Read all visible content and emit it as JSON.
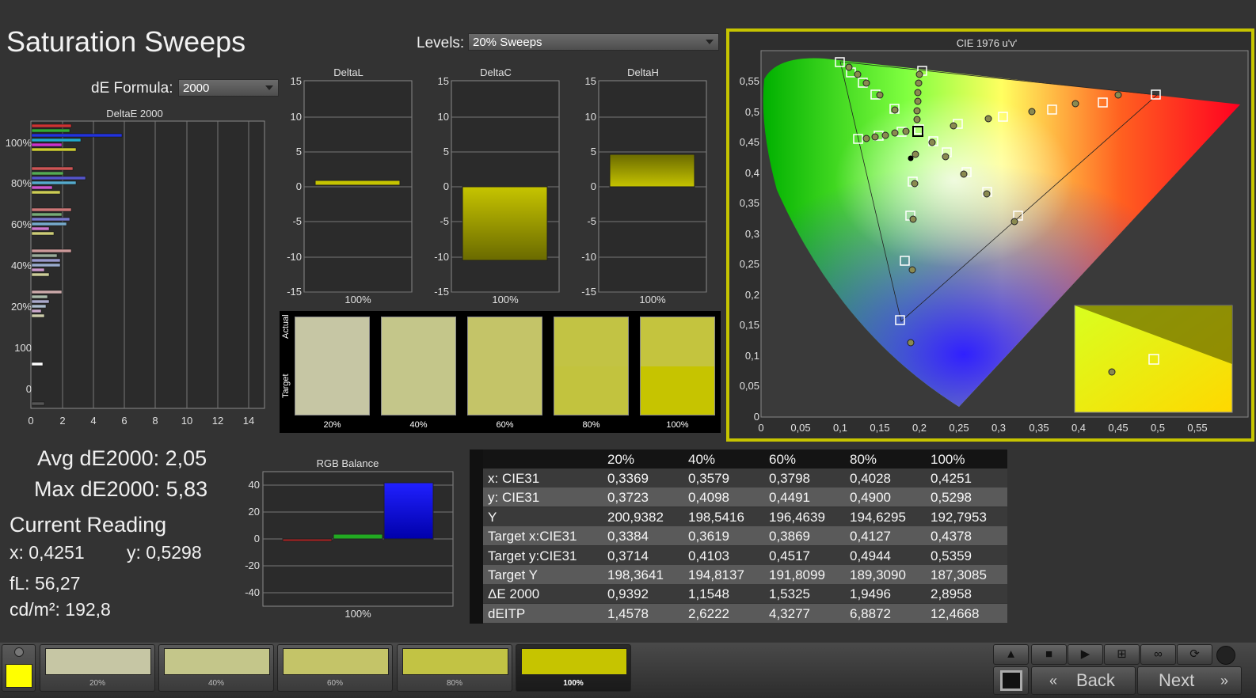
{
  "title": "Saturation Sweeps",
  "levels": {
    "label": "Levels:",
    "value": "20% Sweeps"
  },
  "formula": {
    "label": "dE Formula:",
    "value": "2000"
  },
  "deltae_chart": {
    "title": "DeltaE 2000",
    "x_ticks": [
      "0",
      "2",
      "4",
      "6",
      "8",
      "10",
      "12",
      "14"
    ],
    "y_labels": [
      "100%",
      "80%",
      "60%",
      "40%",
      "20%",
      "100",
      "0"
    ]
  },
  "deltaL": {
    "title": "DeltaL",
    "y_ticks": [
      "15",
      "10",
      "5",
      "0",
      "-5",
      "-10",
      "-15"
    ],
    "x_label": "100%"
  },
  "deltaC": {
    "title": "DeltaC",
    "y_ticks": [
      "15",
      "10",
      "5",
      "0",
      "-5",
      "-10",
      "-15"
    ],
    "x_label": "100%"
  },
  "deltaH": {
    "title": "DeltaH",
    "y_ticks": [
      "15",
      "10",
      "5",
      "0",
      "-5",
      "-10",
      "-15"
    ],
    "x_label": "100%"
  },
  "swatches": {
    "actual_label": "Actual",
    "target_label": "Target",
    "items": [
      {
        "label": "20%",
        "actual": "#c6c6a4",
        "target": "#c6c6a4"
      },
      {
        "label": "40%",
        "actual": "#c4c68a",
        "target": "#c4c68a"
      },
      {
        "label": "60%",
        "actual": "#c4c468",
        "target": "#c4c468"
      },
      {
        "label": "80%",
        "actual": "#c2c344",
        "target": "#c2c33e"
      },
      {
        "label": "100%",
        "actual": "#c4c43e",
        "target": "#c6c400"
      }
    ]
  },
  "cie": {
    "title": "CIE 1976 u'v'",
    "x_ticks": [
      "0",
      "0,05",
      "0,1",
      "0,15",
      "0,2",
      "0,25",
      "0,3",
      "0,35",
      "0,4",
      "0,45",
      "0,5",
      "0,55"
    ],
    "y_ticks": [
      "0",
      "0,05",
      "0,1",
      "0,15",
      "0,2",
      "0,25",
      "0,3",
      "0,35",
      "0,4",
      "0,45",
      "0,5",
      "0,55"
    ]
  },
  "stats": {
    "avg": "Avg dE2000: 2,05",
    "max": "Max dE2000: 5,83",
    "current_reading": "Current Reading",
    "x": "x: 0,4251",
    "y": "y: 0,5298",
    "fl": "fL: 56,27",
    "cdm2": "cd/m²: 192,8"
  },
  "rgb_balance": {
    "title": "RGB Balance",
    "y_ticks": [
      "40",
      "20",
      "0",
      "-20",
      "-40"
    ],
    "x_label": "100%"
  },
  "table": {
    "headers": [
      "20%",
      "40%",
      "60%",
      "80%",
      "100%"
    ],
    "rows": [
      {
        "label": "x: CIE31",
        "values": [
          "0,3369",
          "0,3579",
          "0,3798",
          "0,4028",
          "0,4251"
        ]
      },
      {
        "label": "y: CIE31",
        "values": [
          "0,3723",
          "0,4098",
          "0,4491",
          "0,4900",
          "0,5298"
        ]
      },
      {
        "label": "Y",
        "values": [
          "200,9382",
          "198,5416",
          "196,4639",
          "194,6295",
          "192,7953"
        ]
      },
      {
        "label": "Target x:CIE31",
        "values": [
          "0,3384",
          "0,3619",
          "0,3869",
          "0,4127",
          "0,4378"
        ]
      },
      {
        "label": "Target y:CIE31",
        "values": [
          "0,3714",
          "0,4103",
          "0,4517",
          "0,4944",
          "0,5359"
        ]
      },
      {
        "label": "Target Y",
        "values": [
          "198,3641",
          "194,8137",
          "191,8099",
          "189,3090",
          "187,3085"
        ]
      },
      {
        "label": "ΔE 2000",
        "values": [
          "0,9392",
          "1,1548",
          "1,5325",
          "1,9496",
          "2,8958"
        ]
      },
      {
        "label": "dEITP",
        "values": [
          "1,4578",
          "2,6222",
          "4,3277",
          "6,8872",
          "12,4668"
        ]
      }
    ]
  },
  "bottom_swatches": [
    {
      "label": "20%",
      "color": "#c6c6a4"
    },
    {
      "label": "40%",
      "color": "#c4c68a"
    },
    {
      "label": "60%",
      "color": "#c4c468"
    },
    {
      "label": "80%",
      "color": "#c2c344"
    },
    {
      "label": "100%",
      "color": "#c6c400"
    }
  ],
  "nav": {
    "back": "Back",
    "next": "Next"
  }
}
